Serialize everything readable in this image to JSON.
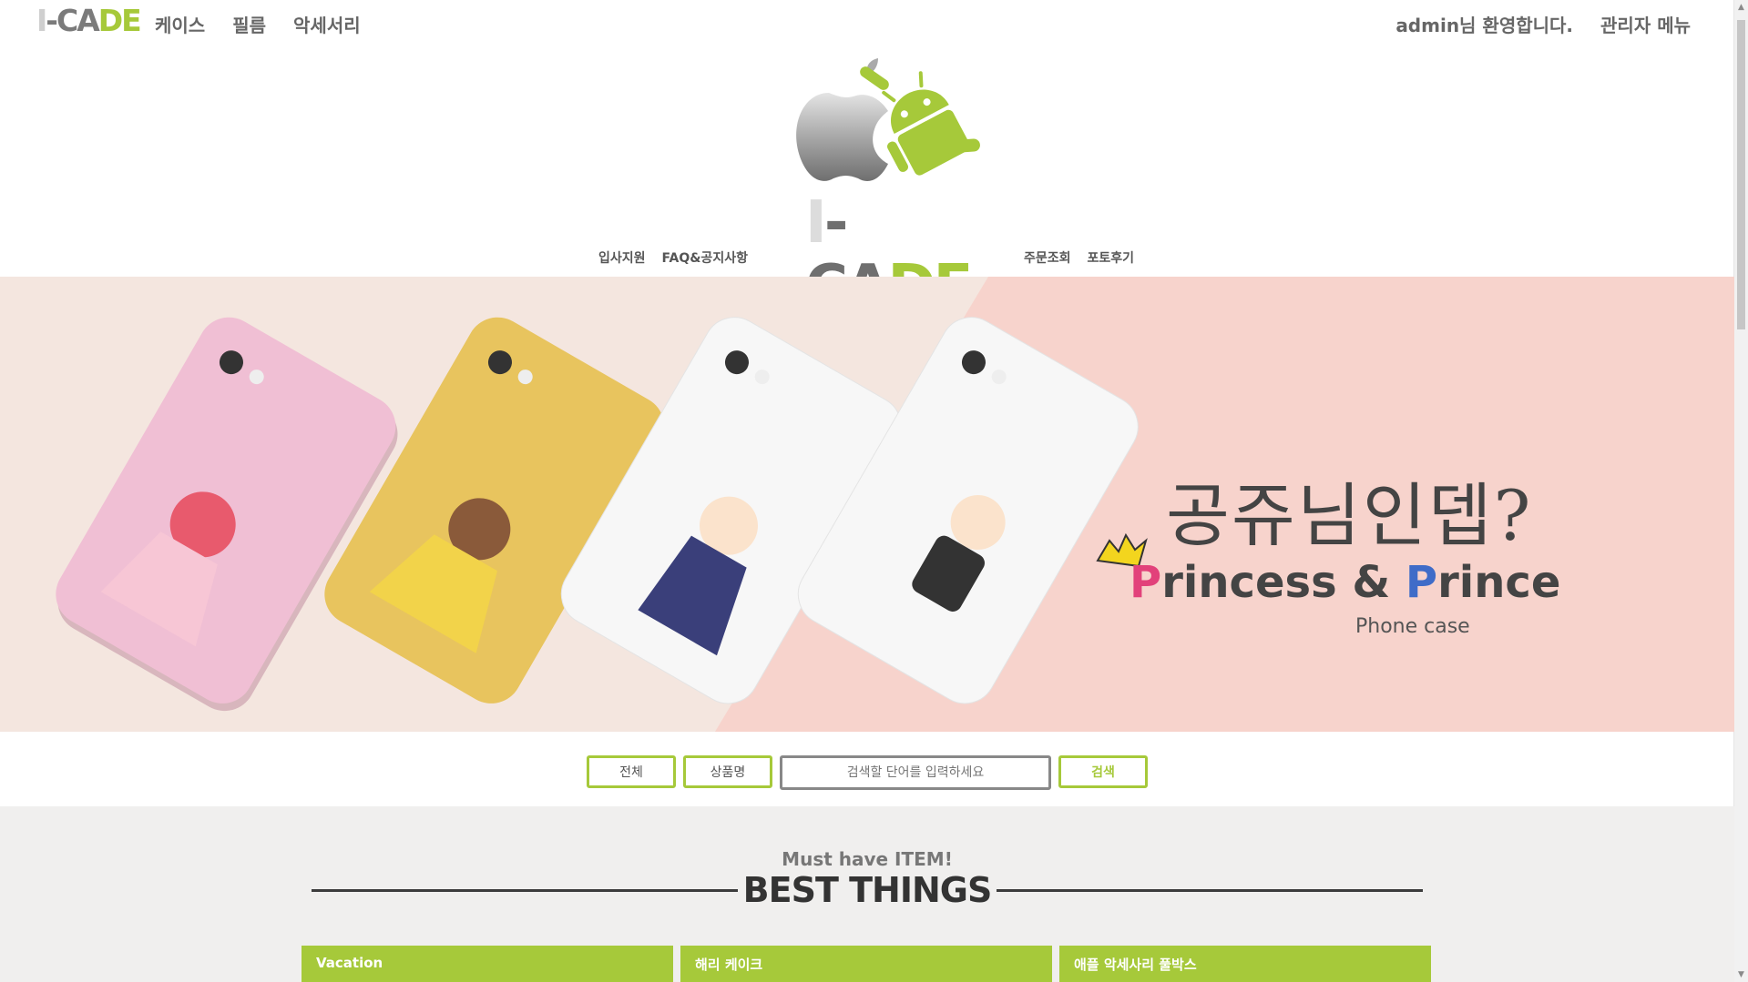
{
  "topbar": {
    "logo": {
      "part1": "I",
      "part2": "-CA",
      "part3": "DE"
    },
    "nav": [
      "케이스",
      "필름",
      "악세서리"
    ],
    "welcome": "admin님 환영합니다.",
    "admin_menu": "관리자 메뉴"
  },
  "header": {
    "wordmark": {
      "part1": "I",
      "part2": "-CA",
      "part3": "DE"
    },
    "left_links": [
      "입사지원",
      "FAQ&공지사항"
    ],
    "right_links": [
      "주문조회",
      "포토후기"
    ]
  },
  "banner": {
    "headline_ko": "공쥬님인뎁?",
    "headline_en": {
      "p1": "P",
      "r1": "rincess & ",
      "p2": "P",
      "r2": "rince"
    },
    "subline": "Phone case",
    "colors": {
      "left_bg": "#f4e6df",
      "right_bg": "#f7d3cc"
    }
  },
  "search": {
    "all_label": "전체",
    "name_label": "상품명",
    "placeholder": "검색할 단어를 입력하세요",
    "search_label": "검색"
  },
  "best": {
    "kicker": "Must have ITEM!",
    "title": "BEST THINGS",
    "cards": [
      "Vacation",
      "해리 케이크",
      "애플 악세사리 풀박스"
    ]
  },
  "accent_color": "#a6c93a"
}
